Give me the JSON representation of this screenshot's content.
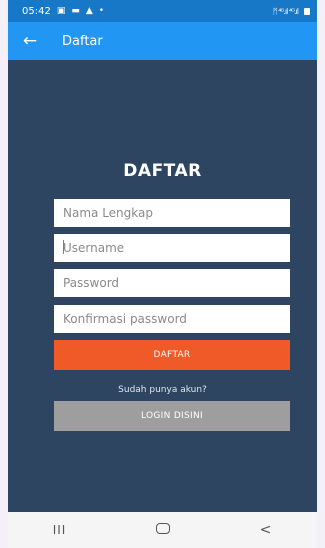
{
  "status_bar": {
    "time": "05:42",
    "left_icons": [
      "message-icon",
      "cast-icon",
      "alert-icon",
      "dot-icon"
    ],
    "right_text": "ᛗ ⁴ᴳ.ıl ⁴ᴳ.ıl",
    "right_icons": [
      "alarm-icon",
      "signal-icon",
      "battery-icon"
    ]
  },
  "app_bar": {
    "title": "Daftar",
    "back_icon": "arrow-left-icon"
  },
  "form": {
    "heading": "DAFTAR",
    "fields": [
      {
        "placeholder": "Nama Lengkap",
        "value": ""
      },
      {
        "placeholder": "Username",
        "value": ""
      },
      {
        "placeholder": "Password",
        "value": ""
      },
      {
        "placeholder": "Konfirmasi password",
        "value": ""
      }
    ],
    "submit_label": "DAFTAR",
    "have_account_text": "Sudah punya akun?",
    "login_label": "LOGIN DISINI"
  },
  "nav_bar": {
    "recent_icon": "III",
    "home_icon": "home-icon",
    "back_icon": "<"
  },
  "colors": {
    "status_bar": "#1778c8",
    "app_bar": "#2196f3",
    "background": "#2d4561",
    "submit_button": "#f05a28",
    "login_button": "#9e9e9e"
  }
}
